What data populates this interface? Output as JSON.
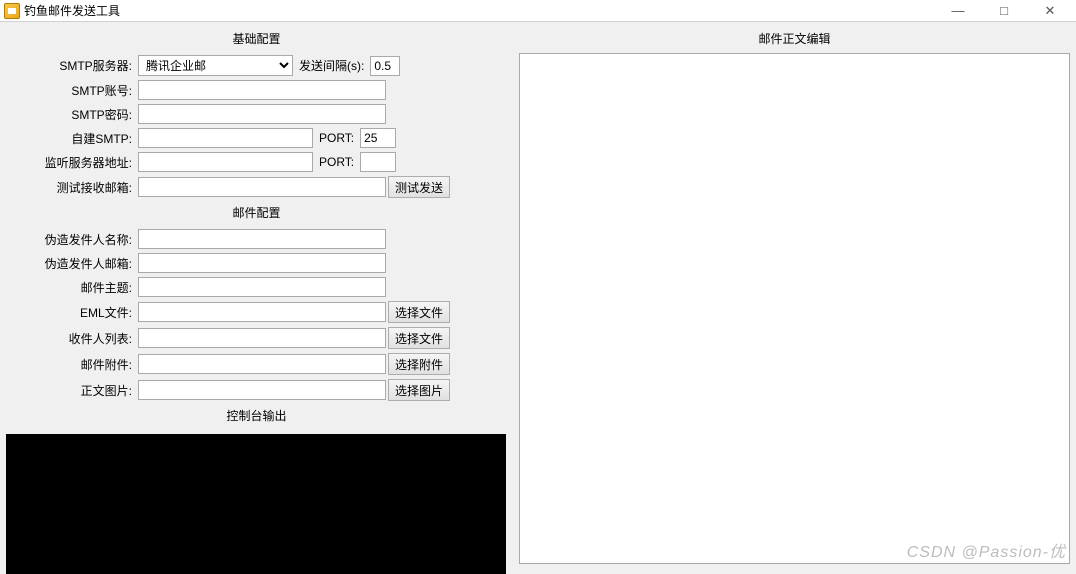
{
  "window": {
    "title": "钓鱼邮件发送工具",
    "minimize": "—",
    "maximize": "□",
    "close": "✕"
  },
  "sections": {
    "basic": "基础配置",
    "mail": "邮件配置",
    "console": "控制台输出",
    "editor": "邮件正文编辑"
  },
  "basic": {
    "smtp_server_label": "SMTP服务器:",
    "smtp_server_value": "腾讯企业邮",
    "interval_label": "发送间隔(s):",
    "interval_value": "0.5",
    "smtp_account_label": "SMTP账号:",
    "smtp_account_value": "",
    "smtp_password_label": "SMTP密码:",
    "smtp_password_value": "",
    "custom_smtp_label": "自建SMTP:",
    "custom_smtp_value": "",
    "port_label": "PORT:",
    "port_value": "25",
    "listen_addr_label": "监听服务器地址:",
    "listen_addr_value": "",
    "listen_port_value": "",
    "test_recv_label": "测试接收邮箱:",
    "test_recv_value": "",
    "test_send_btn": "测试发送"
  },
  "mail": {
    "fake_name_label": "伪造发件人名称:",
    "fake_name_value": "",
    "fake_email_label": "伪造发件人邮箱:",
    "fake_email_value": "",
    "subject_label": "邮件主题:",
    "subject_value": "",
    "eml_label": "EML文件:",
    "eml_value": "",
    "recipients_label": "收件人列表:",
    "recipients_value": "",
    "attachment_label": "邮件附件:",
    "attachment_value": "",
    "body_image_label": "正文图片:",
    "body_image_value": "",
    "choose_file_btn": "选择文件",
    "choose_attachment_btn": "选择附件",
    "choose_image_btn": "选择图片"
  },
  "watermark": "CSDN @Passion-优"
}
